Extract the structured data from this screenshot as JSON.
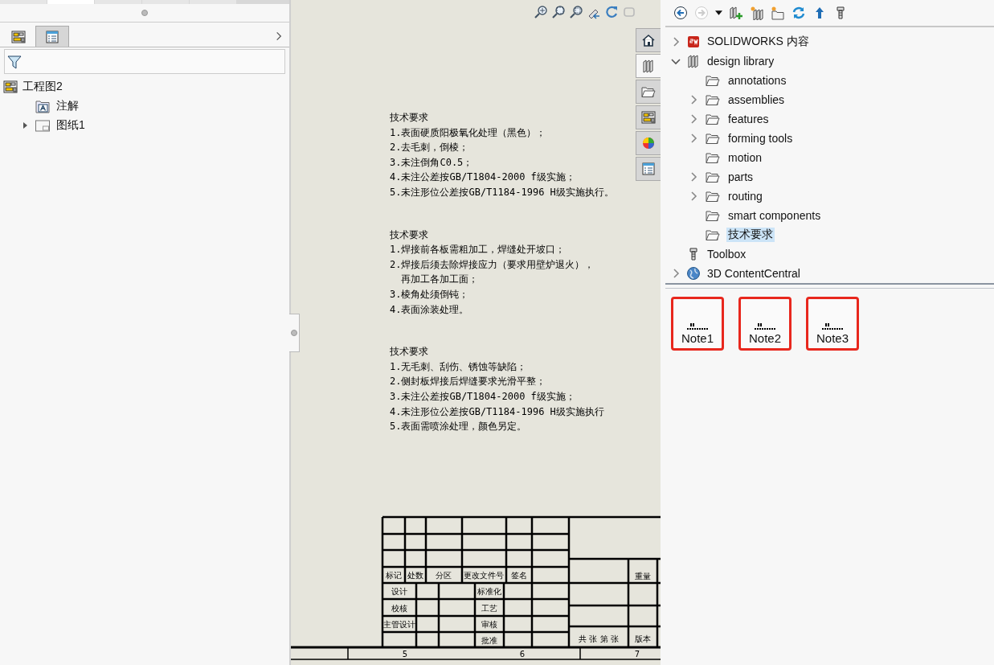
{
  "left_panel": {
    "tabs": [
      {
        "kind": "feature-tree",
        "selected": false
      },
      {
        "kind": "property-list",
        "selected": true
      }
    ],
    "tree": [
      {
        "label": "工程图2",
        "kind": "drawing",
        "children": [
          {
            "label": "注解",
            "kind": "annotations"
          },
          {
            "label": "图纸1",
            "kind": "sheet",
            "expanded": false
          }
        ]
      }
    ]
  },
  "drawing": {
    "notes": [
      {
        "title": "技术要求",
        "lines": [
          {
            "kind": "item",
            "text": "1.表面硬质阳极氧化处理（黑色）；"
          },
          {
            "kind": "item",
            "text": "2.去毛刺，倒棱；"
          },
          {
            "kind": "item",
            "text": "3.未注倒角C0.5；"
          },
          {
            "kind": "item",
            "text": "4.未注公差按GB/T1804-2000 f级实施；"
          },
          {
            "kind": "item",
            "text": "5.未注形位公差按GB/T1184-1996 H级实施执行。"
          }
        ]
      },
      {
        "title": "技术要求",
        "lines": [
          {
            "kind": "item",
            "text": "1.焊接前各板需粗加工，焊缝处开坡口；"
          },
          {
            "kind": "item",
            "text": "2.焊接后须去除焊接应力（要求用壁炉退火），"
          },
          {
            "kind": "continuation",
            "text": "再加工各加工面；"
          },
          {
            "kind": "item",
            "text": "3.棱角处须倒钝；"
          },
          {
            "kind": "item",
            "text": "4.表面涂装处理。"
          }
        ]
      },
      {
        "title": "技术要求",
        "lines": [
          {
            "kind": "item",
            "text": "1.无毛刺、刮伤、锈蚀等缺陷；"
          },
          {
            "kind": "item",
            "text": "2.侧封板焊接后焊缝要求光滑平整；"
          },
          {
            "kind": "item",
            "text": "3.未注公差按GB/T1804-2000 f级实施；"
          },
          {
            "kind": "item",
            "text": "4.未注形位公差按GB/T1184-1996 H级实施执行"
          },
          {
            "kind": "item",
            "text": "5.表面需喷涂处理，颜色另定。"
          }
        ]
      }
    ],
    "title_block": {
      "labels": [
        "标记",
        "处数",
        "分区",
        "更改文件号",
        "签名",
        "设计",
        "标准化",
        "校核",
        "工艺",
        "主管设计",
        "审核",
        "批准",
        "重量",
        "共 张 第 张",
        "版本"
      ],
      "zones": [
        "5",
        "6",
        "7"
      ]
    }
  },
  "task_pane_tabs": [
    {
      "kind": "home",
      "selected": false
    },
    {
      "kind": "library",
      "selected": true
    },
    {
      "kind": "folder",
      "selected": false
    },
    {
      "kind": "drawing",
      "selected": false
    },
    {
      "kind": "appearance",
      "selected": false
    },
    {
      "kind": "properties",
      "selected": false
    }
  ],
  "library": {
    "tree": [
      {
        "label": "SOLIDWORKS 内容",
        "kind": "sw",
        "expanded": false,
        "selected": false
      },
      {
        "label": "design library",
        "kind": "library",
        "expanded": true,
        "selected": false,
        "children": [
          {
            "label": "annotations",
            "kind": "folder",
            "selected": false
          },
          {
            "label": "assemblies",
            "kind": "folder",
            "expanded": false,
            "selected": false
          },
          {
            "label": "features",
            "kind": "folder",
            "expanded": false,
            "selected": false
          },
          {
            "label": "forming tools",
            "kind": "folder",
            "expanded": false,
            "selected": false
          },
          {
            "label": "motion",
            "kind": "folder",
            "selected": false
          },
          {
            "label": "parts",
            "kind": "folder",
            "expanded": false,
            "selected": false
          },
          {
            "label": "routing",
            "kind": "folder",
            "expanded": false,
            "selected": false
          },
          {
            "label": "smart components",
            "kind": "folder",
            "selected": false
          },
          {
            "label": "技术要求",
            "kind": "folder",
            "selected": true
          }
        ]
      },
      {
        "label": "Toolbox",
        "kind": "toolbox",
        "selected": false
      },
      {
        "label": "3D ContentCentral",
        "kind": "globe",
        "expanded": false,
        "selected": false
      }
    ],
    "items": [
      {
        "label": "Note1"
      },
      {
        "label": "Note2"
      },
      {
        "label": "Note3"
      }
    ]
  }
}
